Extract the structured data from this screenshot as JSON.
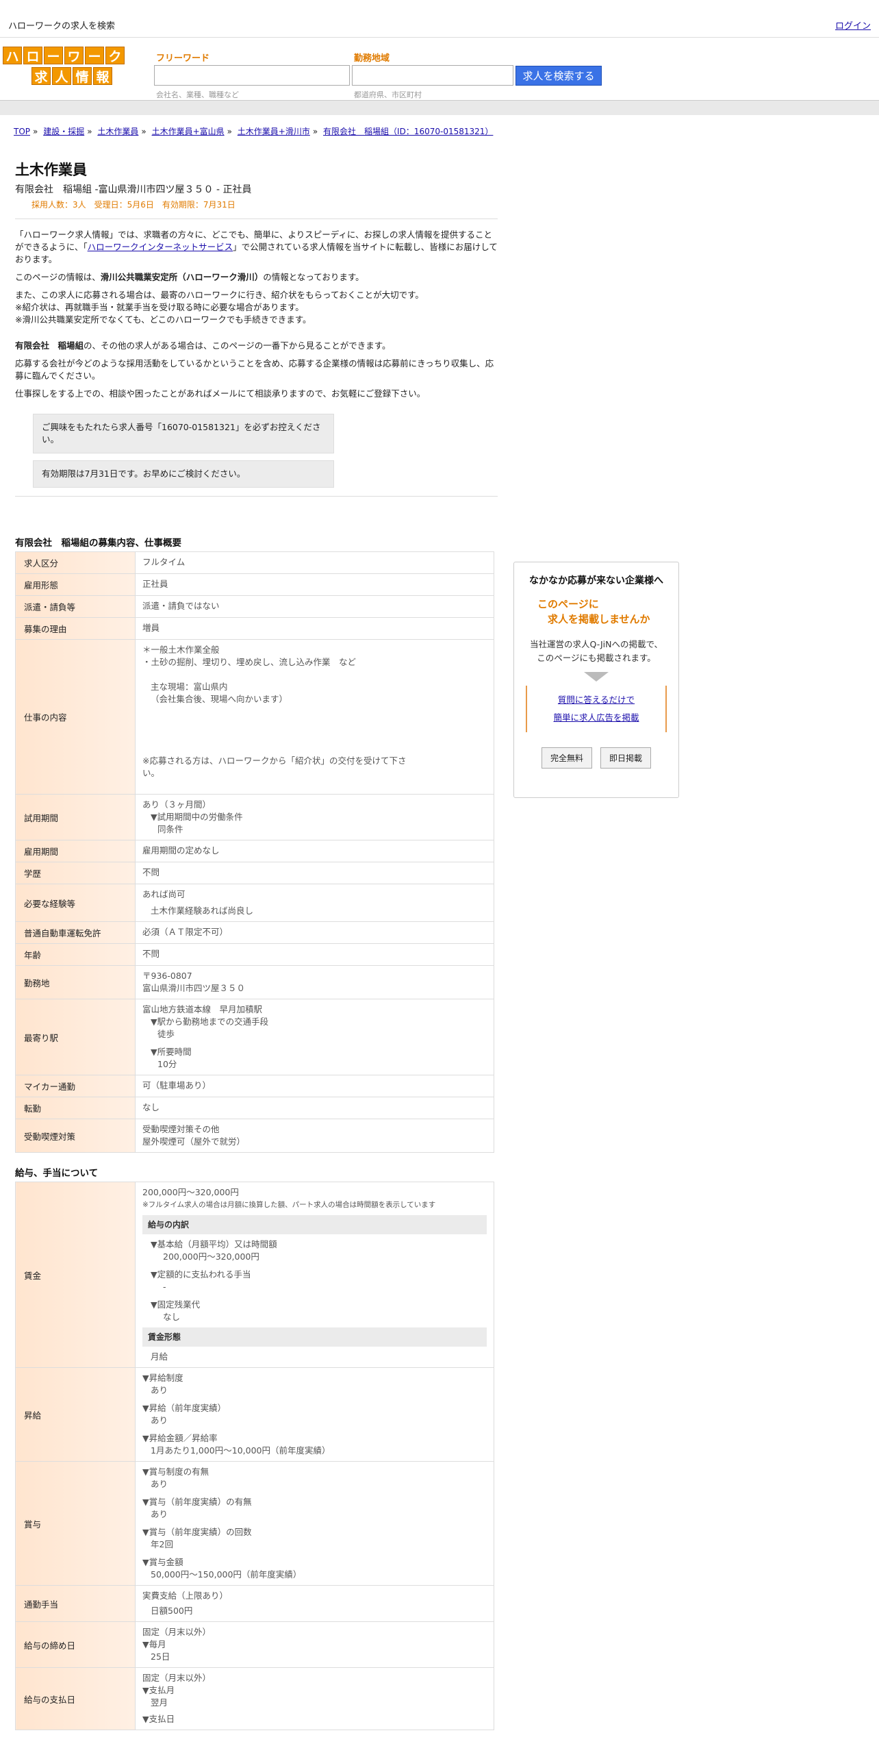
{
  "topbar": {
    "tagline": "ハローワークの求人を検索",
    "login": "ログイン"
  },
  "logo": {
    "row1": [
      "ハ",
      "ロ",
      "ー",
      "ワ",
      "ー",
      "ク"
    ],
    "row2": [
      "求",
      "人",
      "情",
      "報"
    ]
  },
  "search": {
    "freeword_label": "フリーワード",
    "freeword_hint": "会社名、業種、職種など",
    "area_label": "勤務地域",
    "area_hint": "都道府県、市区町村",
    "button": "求人を検索する"
  },
  "breadcrumb": [
    "TOP",
    "建設・採掘",
    "土木作業員",
    "土木作業員+富山県",
    "土木作業員+滑川市",
    "有限会社　稲場組（ID：16070-01581321）"
  ],
  "job": {
    "title": "土木作業員",
    "subtitle": "有限会社　稲場組 -富山県滑川市四ツ屋３５０ - 正社員",
    "meta": "採用人数：3人　受理日：5月6日　有効期限：7月31日"
  },
  "intro": {
    "p1_a": "「ハローワーク求人情報」では、求職者の方々に、どこでも、簡単に、よりスピーディに、お探しの求人情報を提供することができるように、「",
    "p1_link": "ハローワークインターネットサービス",
    "p1_b": "」で公開されている求人情報を当サイトに転載し、皆様にお届けしております。",
    "p2_a": "このページの情報は、",
    "p2_bold": "滑川公共職業安定所（ハローワーク滑川）",
    "p2_b": "の情報となっております。",
    "p3_1": "また、この求人に応募される場合は、最寄のハローワークに行き、紹介状をもらっておくことが大切です。",
    "p3_2": "※紹介状は、再就職手当・就業手当を受け取る時に必要な場合があります。",
    "p3_3": "※滑川公共職業安定所でなくても、どこのハローワークでも手続きできます。",
    "p4_bold": "有限会社　稲場組",
    "p4_b": "の、その他の求人がある場合は、このページの一番下から見ることができます。",
    "p5": "応募する会社が今どのような採用活動をしているかということを含め、応募する企業様の情報は応募前にきっちり収集し、応募に臨んでください。",
    "p6": "仕事探しをする上での、相談や困ったことがあればメールにて相談承りますので、お気軽にご登録下さい。",
    "note1": "ご興味をもたれたら求人番号「16070-01581321」を必ずお控えください。",
    "note2": "有効期限は7月31日です。お早めにご検討ください。"
  },
  "overview": {
    "title": "有限会社　稲場組の募集内容、仕事概要",
    "rows": {
      "kubun": {
        "label": "求人区分",
        "value": "フルタイム"
      },
      "koyou": {
        "label": "雇用形態",
        "value": "正社員"
      },
      "haken": {
        "label": "派遣・請負等",
        "value": "派遣・請負ではない"
      },
      "riyuu": {
        "label": "募集の理由",
        "value": "増員"
      },
      "naiyou": {
        "label": "仕事の内容",
        "l1": "＊一般土木作業全般",
        "l2": "・土砂の掘削、埋切り、埋め戻し、流し込み作業　など",
        "l3": "主な現場：富山県内",
        "l4": "（会社集合後、現場へ向かいます）",
        "l5": "※応募される方は、ハローワークから「紹介状」の交付を受けて下さい。"
      },
      "shiyou": {
        "label": "試用期間",
        "l1": "あり（３ヶ月間）",
        "l2": "▼試用期間中の労働条件",
        "l3": "同条件"
      },
      "kikan": {
        "label": "雇用期間",
        "value": "雇用期間の定めなし"
      },
      "gakureki": {
        "label": "学歴",
        "value": "不問"
      },
      "keiken": {
        "label": "必要な経験等",
        "l1": "あれば尚可",
        "l2": "土木作業経験あれば尚良し"
      },
      "menkyo": {
        "label": "普通自動車運転免許",
        "value": "必須（ＡＴ限定不可）"
      },
      "nenrei": {
        "label": "年齢",
        "value": "不問"
      },
      "kinmuchi": {
        "label": "勤務地",
        "l1": "〒936-0807",
        "l2": "富山県滑川市四ツ屋３５０"
      },
      "eki": {
        "label": "最寄り駅",
        "l1": "富山地方鉄道本線　早月加積駅",
        "l2": "▼駅から勤務地までの交通手段",
        "l3": "徒歩",
        "l4": "▼所要時間",
        "l5": "10分"
      },
      "mycar": {
        "label": "マイカー通勤",
        "value": "可（駐車場あり）"
      },
      "tenkin": {
        "label": "転勤",
        "value": "なし"
      },
      "kitsuen": {
        "label": "受動喫煙対策",
        "l1": "受動喫煙対策その他",
        "l2": "屋外喫煙可（屋外で就労）"
      }
    }
  },
  "salary": {
    "title": "給与、手当について",
    "chingin": {
      "label": "賃金",
      "range": "200,000円〜320,000円",
      "note": "※フルタイム求人の場合は月額に換算した額、パート求人の場合は時間額を表示しています",
      "sub1": "給与の内訳",
      "b1": "▼基本給（月額平均）又は時間額",
      "b1v": "200,000円〜320,000円",
      "b2": "▼定額的に支払われる手当",
      "b2v": "-",
      "b3": "▼固定残業代",
      "b3v": "なし",
      "sub2": "賃金形態",
      "form": "月給"
    },
    "shoukyu": {
      "label": "昇給",
      "a": "▼昇給制度",
      "av": "あり",
      "b": "▼昇給（前年度実績）",
      "bv": "あり",
      "c": "▼昇給金額／昇給率",
      "cv": "1月あたり1,000円〜10,000円（前年度実績）"
    },
    "shouyo": {
      "label": "賞与",
      "a": "▼賞与制度の有無",
      "av": "あり",
      "b": "▼賞与（前年度実績）の有無",
      "bv": "あり",
      "c": "▼賞与（前年度実績）の回数",
      "cv": "年2回",
      "d": "▼賞与金額",
      "dv": "50,000円〜150,000円（前年度実績）"
    },
    "tsukin": {
      "label": "通勤手当",
      "l1": "実費支給（上限あり）",
      "l2": "日額500円"
    },
    "shime": {
      "label": "給与の締め日",
      "l1": "固定（月末以外）",
      "l2": "▼毎月",
      "l3": "25日"
    },
    "shiharai": {
      "label": "給与の支払日",
      "l1": "固定（月末以外）",
      "l2": "▼支払月",
      "l3": "翌月",
      "l4": "▼支払日"
    }
  },
  "ad": {
    "heading": "なかなか応募が来ない企業様へ",
    "orange1": "このページに",
    "orange2": "　求人を掲載しませんか",
    "desc1": "当社運営の求人Q-JiNへの掲載で、",
    "desc2": "このページにも掲載されます。",
    "link1": "質問に答えるだけで",
    "link2": "簡単に求人広告を掲載",
    "btn1": "完全無料",
    "btn2": "即日掲載"
  }
}
